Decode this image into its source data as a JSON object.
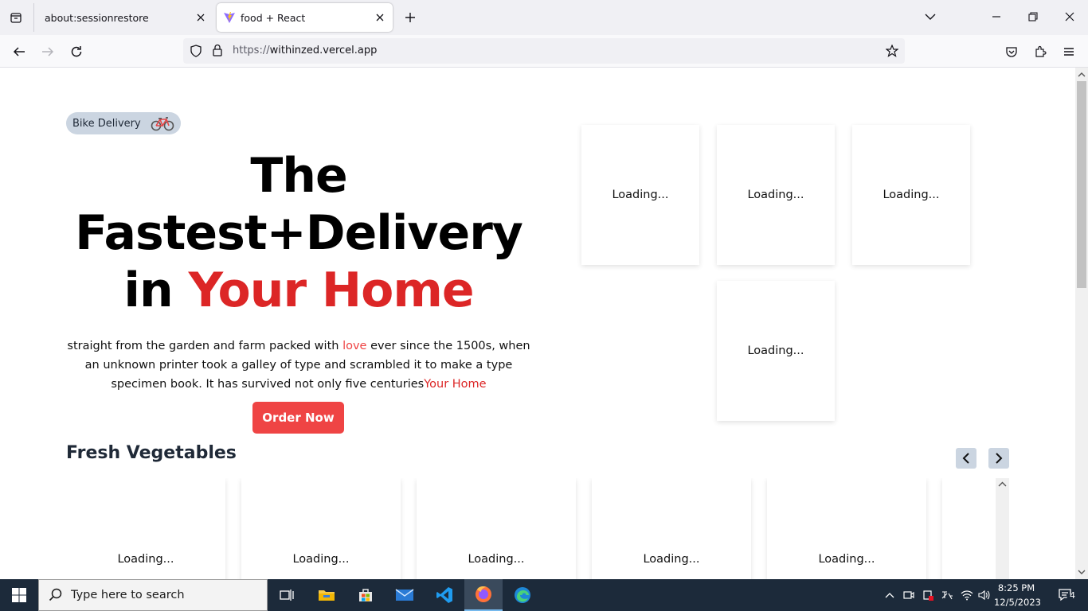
{
  "browser": {
    "tabs": [
      {
        "title": "about:sessionrestore",
        "active": false
      },
      {
        "title": "food + React",
        "active": true
      }
    ],
    "url_scheme": "https://",
    "url_host": "withinzed.vercel.app"
  },
  "hero": {
    "badge_label": "Bike Delivery",
    "title_line1": "The",
    "title_line2": "Fastest+Delivery",
    "title_line3_prefix": "in ",
    "title_line3_highlight": "Your Home",
    "desc_part1": "straight from the garden and farm packed with ",
    "desc_love": "love",
    "desc_part2": " ever since the 1500s, when an unknown printer took a galley of type and scrambled it to make a type specimen book. It has survived not only five centuries",
    "desc_highlight": "Your Home",
    "order_button": "Order Now",
    "cards": [
      "Loading...",
      "Loading...",
      "Loading...",
      "Loading..."
    ]
  },
  "fresh_vegetables": {
    "title": "Fresh Vegetables",
    "cards": [
      "Loading...",
      "Loading...",
      "Loading...",
      "Loading...",
      "Loading...",
      ""
    ]
  },
  "taskbar": {
    "search_placeholder": "Type here to search",
    "time": "8:25 PM",
    "date": "12/5/2023",
    "notification_count": "4"
  },
  "colors": {
    "accent_red": "#dc2626",
    "button_red": "#ef4444",
    "badge_bg": "#cbd5e1",
    "taskbar_bg": "#1c2a3a"
  }
}
